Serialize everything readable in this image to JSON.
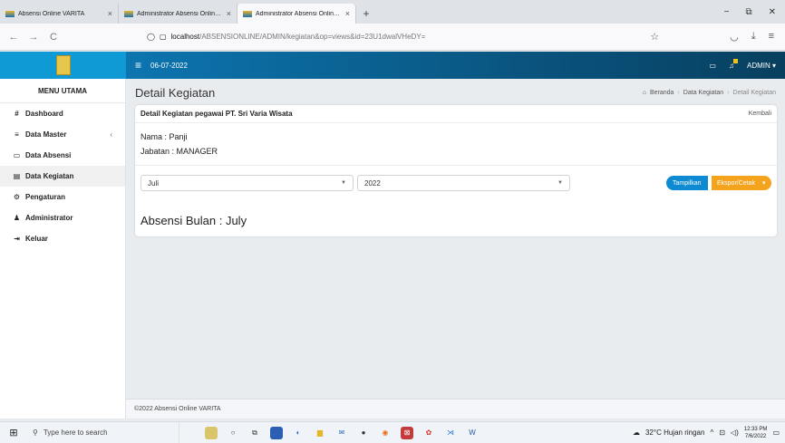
{
  "browser": {
    "tabs": [
      {
        "title": "Absensi Online VARITA",
        "close": "×",
        "active": false
      },
      {
        "title": "Administrator Absensi Online V",
        "close": "×",
        "active": false
      },
      {
        "title": "Administrator Absensi Online V",
        "close": "×",
        "active": true
      }
    ],
    "new_tab": "+",
    "window_controls": [
      "−",
      "⧉",
      "✕"
    ],
    "nav": {
      "back": "←",
      "forward": "→",
      "reload": "C"
    },
    "url_host": "localhost",
    "url_path": "/ABSENSIONLINE/ADMIN/kegiatan&op=views&id=23U1dwalVHeDY="
  },
  "header": {
    "date": "06-07-2022",
    "user_menu": "ADMIN ▾",
    "hamburger": "≡"
  },
  "sidebar": {
    "title": "MENU UTAMA",
    "items": [
      {
        "label": "Dashboard",
        "icon": "#"
      },
      {
        "label": "Data Master",
        "icon": "≡",
        "chevron": "‹"
      },
      {
        "label": "Data Absensi",
        "icon": "▭"
      },
      {
        "label": "Data Kegiatan",
        "icon": "▤"
      },
      {
        "label": "Pengaturan",
        "icon": "⚙"
      },
      {
        "label": "Administrator",
        "icon": "♟"
      },
      {
        "label": "Keluar",
        "icon": "⇥"
      }
    ]
  },
  "page": {
    "title": "Detail Kegiatan",
    "breadcrumb": [
      "Beranda",
      "Data Kegiatan",
      "Detail Kegiatan"
    ],
    "card_title": "Detail Kegiatan pegawai PT. Sri Varia Wisata",
    "back_label": "Kembali",
    "name_line": "Nama : Panji",
    "position_line": "Jabatan : MANAGER",
    "month_value": "Juli",
    "year_value": "2022",
    "show_button": "Tampilkan",
    "export_button": "Ekspor/Cetak",
    "absensi_heading": "Absensi Bulan : July"
  },
  "footer": {
    "text": "©2022 Absensi Online VARITA"
  },
  "taskbar": {
    "search_placeholder": "Type here to search",
    "weather": "32°C  Hujan ringan",
    "time": "12:33 PM",
    "date": "7/6/2022"
  },
  "colors": {
    "header_start": "#0e7fbf",
    "header_end": "#083f5f",
    "show_button": "#0d8ad1",
    "export_button": "#f3a31c"
  }
}
